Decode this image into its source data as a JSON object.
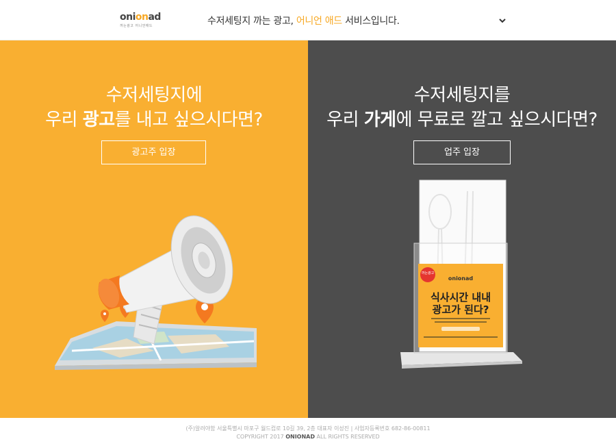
{
  "header": {
    "logo_text_pre": "oni",
    "logo_text_mid": "on",
    "logo_text_post": "ad",
    "logo_sub": "까는광고 어니언애드",
    "tagline_pre": "수저세팅지 까는 광고, ",
    "tagline_highlight": "어니언 애드",
    "tagline_post": " 서비스입니다."
  },
  "advertiser": {
    "headline_line1": "수저세팅지에",
    "headline_pre": "우리 ",
    "headline_bold": "광고",
    "headline_post": "를 내고 싶으시다면?",
    "button_label": "광고주 입장"
  },
  "owner": {
    "headline_line1": "수저세팅지를",
    "headline_pre": "우리 ",
    "headline_bold": "가게",
    "headline_post": "에 무료로 깔고 싶으시다면?",
    "button_label": "업주 입장",
    "card_logo": "onionad",
    "card_badge": "까는광고",
    "card_title_1": "식사시간 내내",
    "card_title_2": "광고가 된다?"
  },
  "footer": {
    "company_info": "(주)알려야함 서울특별시 마포구 월드컵로 10길 39, 2층 대표자 이성진 | 사업자등록번호 682-86-00811",
    "copyright_pre": "COPYRIGHT 2017 ",
    "copyright_brand": "ONIONAD",
    "copyright_post": " ALL RIGHTS RESERVED"
  },
  "colors": {
    "accent": "#f9af31",
    "dark_panel": "#4d4d4d",
    "white": "#ffffff"
  },
  "icons": {
    "menu": "chevron-down-icon",
    "advertiser_illustration": "megaphone-on-map-icon",
    "owner_illustration": "napkin-holder-icon"
  }
}
